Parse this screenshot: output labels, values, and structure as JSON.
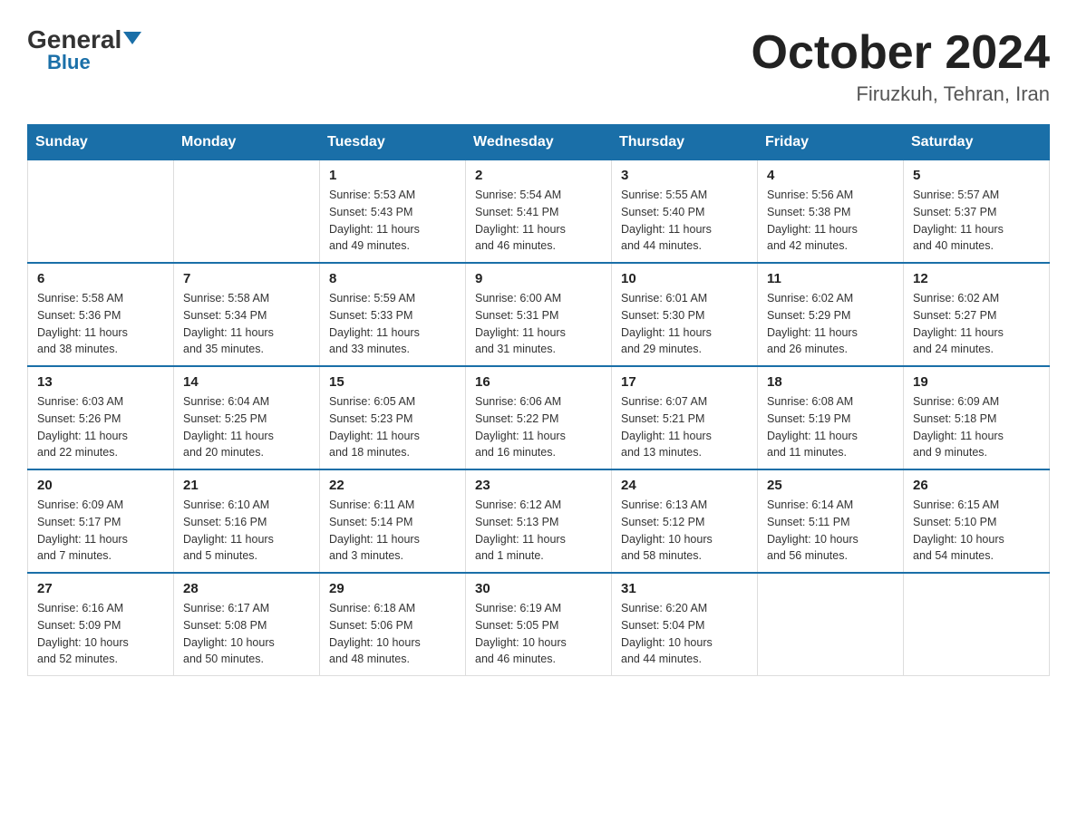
{
  "logo": {
    "general": "General",
    "blue": "Blue"
  },
  "title": "October 2024",
  "location": "Firuzkuh, Tehran, Iran",
  "weekdays": [
    "Sunday",
    "Monday",
    "Tuesday",
    "Wednesday",
    "Thursday",
    "Friday",
    "Saturday"
  ],
  "weeks": [
    [
      {
        "day": "",
        "info": ""
      },
      {
        "day": "",
        "info": ""
      },
      {
        "day": "1",
        "info": "Sunrise: 5:53 AM\nSunset: 5:43 PM\nDaylight: 11 hours\nand 49 minutes."
      },
      {
        "day": "2",
        "info": "Sunrise: 5:54 AM\nSunset: 5:41 PM\nDaylight: 11 hours\nand 46 minutes."
      },
      {
        "day": "3",
        "info": "Sunrise: 5:55 AM\nSunset: 5:40 PM\nDaylight: 11 hours\nand 44 minutes."
      },
      {
        "day": "4",
        "info": "Sunrise: 5:56 AM\nSunset: 5:38 PM\nDaylight: 11 hours\nand 42 minutes."
      },
      {
        "day": "5",
        "info": "Sunrise: 5:57 AM\nSunset: 5:37 PM\nDaylight: 11 hours\nand 40 minutes."
      }
    ],
    [
      {
        "day": "6",
        "info": "Sunrise: 5:58 AM\nSunset: 5:36 PM\nDaylight: 11 hours\nand 38 minutes."
      },
      {
        "day": "7",
        "info": "Sunrise: 5:58 AM\nSunset: 5:34 PM\nDaylight: 11 hours\nand 35 minutes."
      },
      {
        "day": "8",
        "info": "Sunrise: 5:59 AM\nSunset: 5:33 PM\nDaylight: 11 hours\nand 33 minutes."
      },
      {
        "day": "9",
        "info": "Sunrise: 6:00 AM\nSunset: 5:31 PM\nDaylight: 11 hours\nand 31 minutes."
      },
      {
        "day": "10",
        "info": "Sunrise: 6:01 AM\nSunset: 5:30 PM\nDaylight: 11 hours\nand 29 minutes."
      },
      {
        "day": "11",
        "info": "Sunrise: 6:02 AM\nSunset: 5:29 PM\nDaylight: 11 hours\nand 26 minutes."
      },
      {
        "day": "12",
        "info": "Sunrise: 6:02 AM\nSunset: 5:27 PM\nDaylight: 11 hours\nand 24 minutes."
      }
    ],
    [
      {
        "day": "13",
        "info": "Sunrise: 6:03 AM\nSunset: 5:26 PM\nDaylight: 11 hours\nand 22 minutes."
      },
      {
        "day": "14",
        "info": "Sunrise: 6:04 AM\nSunset: 5:25 PM\nDaylight: 11 hours\nand 20 minutes."
      },
      {
        "day": "15",
        "info": "Sunrise: 6:05 AM\nSunset: 5:23 PM\nDaylight: 11 hours\nand 18 minutes."
      },
      {
        "day": "16",
        "info": "Sunrise: 6:06 AM\nSunset: 5:22 PM\nDaylight: 11 hours\nand 16 minutes."
      },
      {
        "day": "17",
        "info": "Sunrise: 6:07 AM\nSunset: 5:21 PM\nDaylight: 11 hours\nand 13 minutes."
      },
      {
        "day": "18",
        "info": "Sunrise: 6:08 AM\nSunset: 5:19 PM\nDaylight: 11 hours\nand 11 minutes."
      },
      {
        "day": "19",
        "info": "Sunrise: 6:09 AM\nSunset: 5:18 PM\nDaylight: 11 hours\nand 9 minutes."
      }
    ],
    [
      {
        "day": "20",
        "info": "Sunrise: 6:09 AM\nSunset: 5:17 PM\nDaylight: 11 hours\nand 7 minutes."
      },
      {
        "day": "21",
        "info": "Sunrise: 6:10 AM\nSunset: 5:16 PM\nDaylight: 11 hours\nand 5 minutes."
      },
      {
        "day": "22",
        "info": "Sunrise: 6:11 AM\nSunset: 5:14 PM\nDaylight: 11 hours\nand 3 minutes."
      },
      {
        "day": "23",
        "info": "Sunrise: 6:12 AM\nSunset: 5:13 PM\nDaylight: 11 hours\nand 1 minute."
      },
      {
        "day": "24",
        "info": "Sunrise: 6:13 AM\nSunset: 5:12 PM\nDaylight: 10 hours\nand 58 minutes."
      },
      {
        "day": "25",
        "info": "Sunrise: 6:14 AM\nSunset: 5:11 PM\nDaylight: 10 hours\nand 56 minutes."
      },
      {
        "day": "26",
        "info": "Sunrise: 6:15 AM\nSunset: 5:10 PM\nDaylight: 10 hours\nand 54 minutes."
      }
    ],
    [
      {
        "day": "27",
        "info": "Sunrise: 6:16 AM\nSunset: 5:09 PM\nDaylight: 10 hours\nand 52 minutes."
      },
      {
        "day": "28",
        "info": "Sunrise: 6:17 AM\nSunset: 5:08 PM\nDaylight: 10 hours\nand 50 minutes."
      },
      {
        "day": "29",
        "info": "Sunrise: 6:18 AM\nSunset: 5:06 PM\nDaylight: 10 hours\nand 48 minutes."
      },
      {
        "day": "30",
        "info": "Sunrise: 6:19 AM\nSunset: 5:05 PM\nDaylight: 10 hours\nand 46 minutes."
      },
      {
        "day": "31",
        "info": "Sunrise: 6:20 AM\nSunset: 5:04 PM\nDaylight: 10 hours\nand 44 minutes."
      },
      {
        "day": "",
        "info": ""
      },
      {
        "day": "",
        "info": ""
      }
    ]
  ]
}
